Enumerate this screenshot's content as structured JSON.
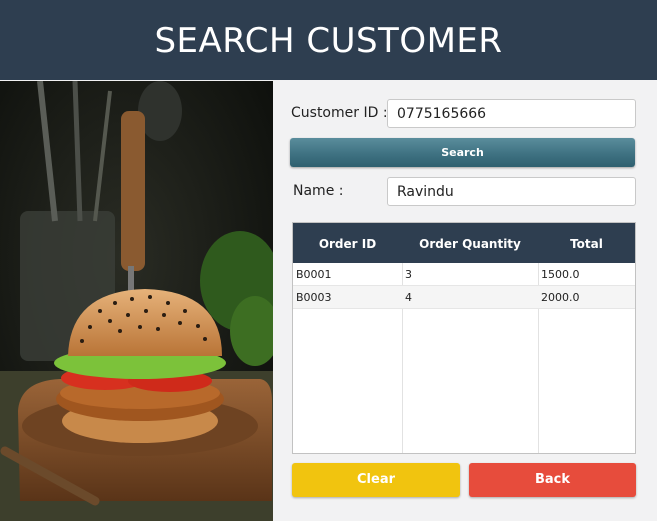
{
  "header": {
    "title": "SEARCH CUSTOMER"
  },
  "form": {
    "customer_id_label": "Customer ID :",
    "customer_id_value": "0775165666",
    "search_label": "Search",
    "name_label": "Name :",
    "name_value": "Ravindu"
  },
  "table": {
    "headers": [
      "Order ID",
      "Order Quantity",
      "Total"
    ],
    "rows": [
      [
        "B0001",
        "3",
        "1500.0"
      ],
      [
        "B0003",
        "4",
        "2000.0"
      ]
    ]
  },
  "buttons": {
    "clear_label": "Clear",
    "back_label": "Back"
  },
  "colors": {
    "header_bg": "#2e3e50",
    "search_button": "#3f7282",
    "clear_button": "#f1c40f",
    "back_button": "#e74c3c"
  }
}
